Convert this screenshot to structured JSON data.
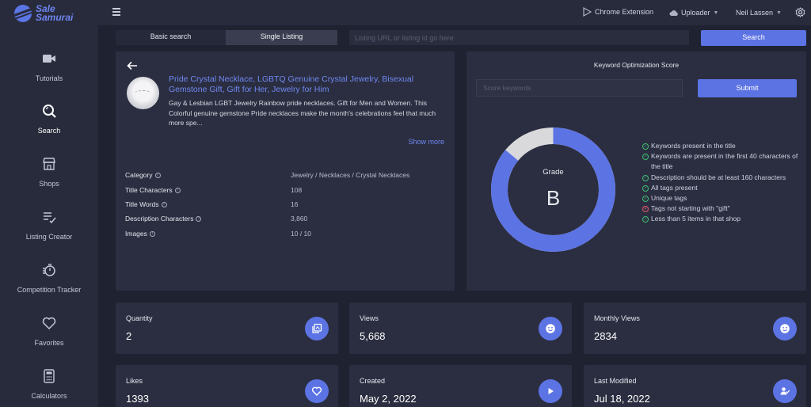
{
  "brand": {
    "line1": "Sale",
    "line2": "Samurai"
  },
  "sidebar": {
    "items": [
      {
        "label": "Tutorials",
        "icon": "video-camera-icon"
      },
      {
        "label": "Search",
        "icon": "search-icon"
      },
      {
        "label": "Shops",
        "icon": "shop-icon"
      },
      {
        "label": "Listing Creator",
        "icon": "edit-list-icon"
      },
      {
        "label": "Competition Tracker",
        "icon": "stopwatch-icon"
      },
      {
        "label": "Favorites",
        "icon": "heart-icon"
      },
      {
        "label": "Calculators",
        "icon": "calculator-icon"
      }
    ],
    "active": "Search"
  },
  "topbar": {
    "chrome_extension": "Chrome Extension",
    "uploader": "Uploader",
    "user": "Neil Lassen"
  },
  "search": {
    "tab_basic": "Basic search",
    "tab_single": "Single Listing",
    "placeholder": "Listing URL or listing id go here",
    "button": "Search"
  },
  "listing": {
    "title": "Pride Crystal Necklace, LGBTQ Genuine Crystal Jewelry, Bisexual Gemstone Gift, Gift for Her, Jewelry for Him",
    "description": "Gay & Lesbian LGBT Jewelry Rainbow pride necklaces. Gift for Men and Women. This Colorful genuine gemstone Pride necklaces make the month's celebrations feel that much more spe...",
    "show_more": "Show more",
    "details": [
      {
        "label": "Category",
        "value": "Jewelry / Necklaces / Crystal Necklaces"
      },
      {
        "label": "Title Characters",
        "value": "108"
      },
      {
        "label": "Title Words",
        "value": "16"
      },
      {
        "label": "Description Characters",
        "value": "3,860"
      },
      {
        "label": "Images",
        "value": "10 / 10"
      }
    ]
  },
  "keyword": {
    "title": "Keyword Optimization Score",
    "placeholder": "Score keywords",
    "submit": "Submit",
    "grade_label": "Grade",
    "grade": "B",
    "score_fraction": 0.86,
    "colors": {
      "fill": "#5c73e4",
      "empty": "#d9d9db"
    },
    "checks": [
      {
        "text": "Keywords present in the title",
        "ok": true
      },
      {
        "text": "Keywords are present in the first 40 characters of the title",
        "ok": true
      },
      {
        "text": "Description should be at least 160 characters",
        "ok": true
      },
      {
        "text": "All tags present",
        "ok": true
      },
      {
        "text": "Unique tags",
        "ok": true
      },
      {
        "text": "Tags not starting with \"gift\"",
        "ok": false
      },
      {
        "text": "Less than 5 items in that shop",
        "ok": true
      }
    ]
  },
  "stats": [
    {
      "label": "Quantity",
      "value": "2",
      "icon": "stack-icon"
    },
    {
      "label": "Views",
      "value": "5,668",
      "icon": "smiley-icon"
    },
    {
      "label": "Monthly Views",
      "value": "2834",
      "icon": "smiley-icon"
    },
    {
      "label": "Likes",
      "value": "1393",
      "icon": "heart-icon"
    },
    {
      "label": "Created",
      "value": "May 2, 2022",
      "icon": "play-icon"
    },
    {
      "label": "Last Modified",
      "value": "Jul 18, 2022",
      "icon": "user-check-icon"
    }
  ]
}
